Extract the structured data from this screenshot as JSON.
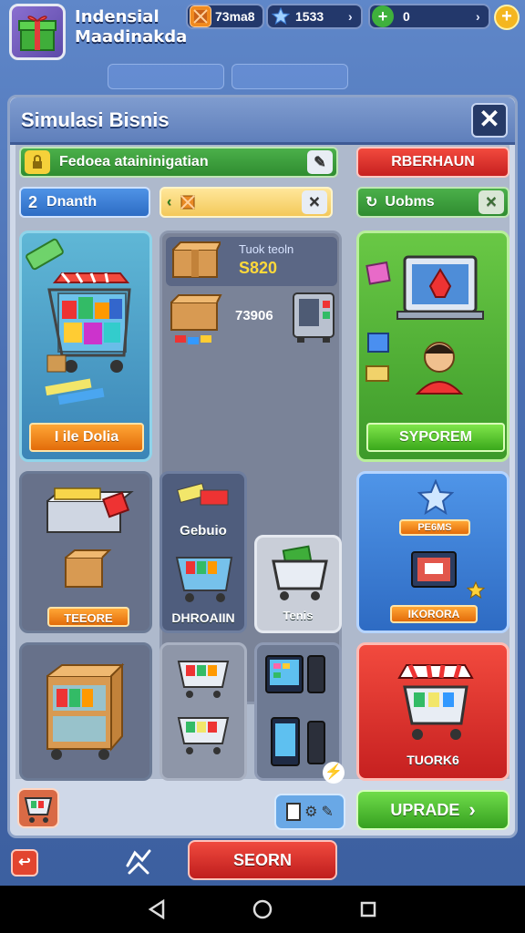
{
  "header": {
    "title_line1": "Indensial",
    "title_line2": "Maadinakda",
    "resource_1": "73ma8",
    "resource_2": "1533",
    "resource_3": "0",
    "coin_symbol": "+"
  },
  "panel": {
    "title": "Simulasi Bisnis",
    "close_symbol": "✕"
  },
  "bars": {
    "task_bar_label": "Fedoea ataininigatian",
    "level_number": "2",
    "level_label": "Dnanth",
    "red_button_label": "RBERHAUN",
    "green_tab_label": "Uobms"
  },
  "tiles": {
    "cart_tile_label": "I ile Dolia",
    "stock_top_label": "Tuok teoln",
    "stock_top_value": "S820",
    "stock_mid_value": "73906",
    "symptom_button_label": "SYPOREM",
    "crate_tile_label": "TEEORE",
    "mid_tile_top_label": "Gebuio",
    "mid_tile_bottom_label": "DHROAIIN",
    "small_cart_label": "Tenis",
    "blue_tile_top_label": "PE6MS",
    "blue_tile_bottom_label": "IKORORA",
    "red_tile_label": "TUORK6"
  },
  "bottom": {
    "upgrade_label": "UPRADE",
    "search_label": "SEORN"
  },
  "colors": {
    "accent_green": "#3aa81b",
    "accent_red": "#d62b2b",
    "accent_orange": "#e36c0a",
    "panel_blue": "#5f7fbb"
  }
}
